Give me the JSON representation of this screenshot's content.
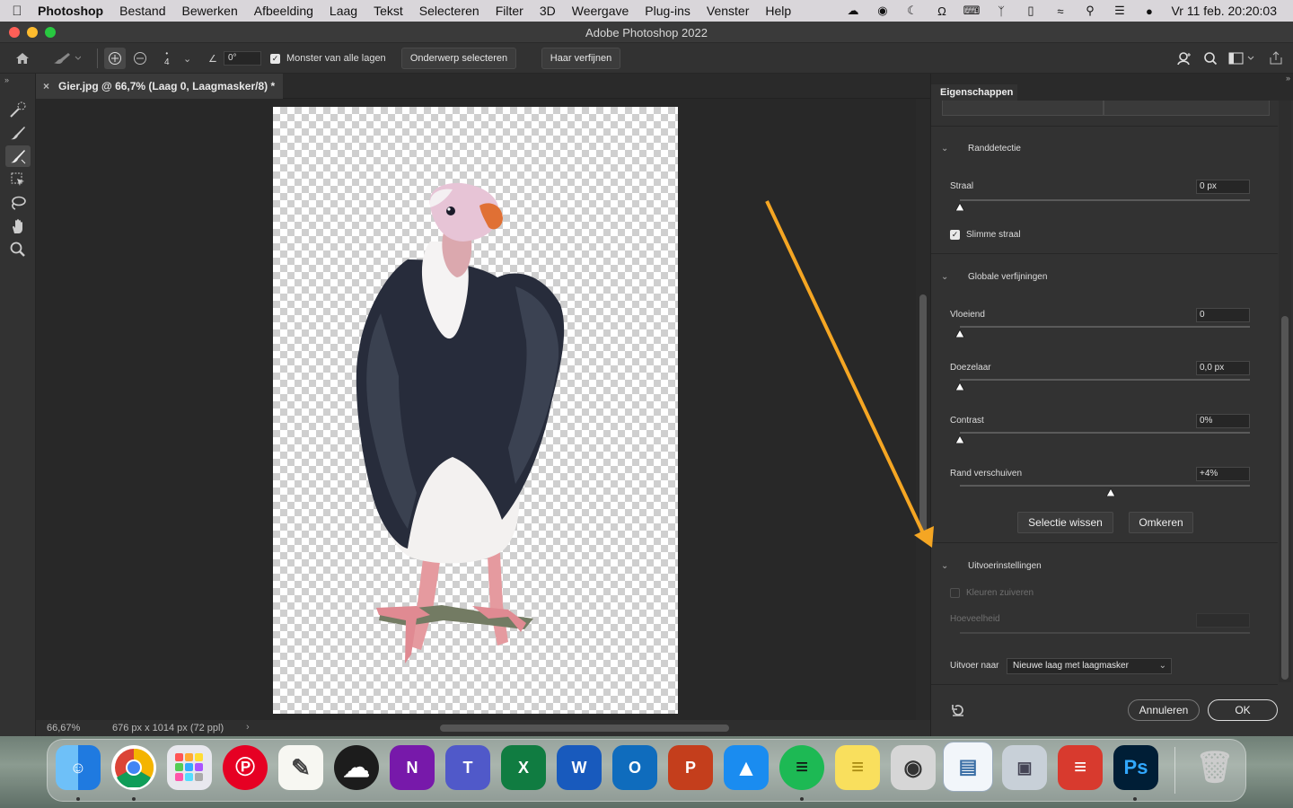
{
  "menubar": {
    "app": "Photoshop",
    "items": [
      "Bestand",
      "Bewerken",
      "Afbeelding",
      "Laag",
      "Tekst",
      "Selecteren",
      "Filter",
      "3D",
      "Weergave",
      "Plug-ins",
      "Venster",
      "Help"
    ],
    "clock": "Vr 11 feb.  20:20:03"
  },
  "window": {
    "title": "Adobe Photoshop 2022"
  },
  "options": {
    "brush_size": "4",
    "angle": "0°",
    "sample_all_label": "Monster van alle lagen",
    "select_subject": "Onderwerp selecteren",
    "refine_hair": "Haar verfijnen"
  },
  "document": {
    "tab_title": "Gier.jpg @ 66,7% (Laag 0, Laagmasker/8) *",
    "zoom": "66,67%",
    "doc_info": "676 px x 1014 px (72 ppl)"
  },
  "properties": {
    "panel_title": "Eigenschappen",
    "partial_tabs": [
      "Randdetectie"
    ],
    "edge_detection": {
      "header": "Randdetectie",
      "radius_label": "Straal",
      "radius_value": "0 px",
      "radius_fraction": 0,
      "smart_radius_label": "Slimme straal"
    },
    "global": {
      "header": "Globale verfijningen",
      "smooth_label": "Vloeiend",
      "smooth_value": "0",
      "smooth_fraction": 0,
      "feather_label": "Doezelaar",
      "feather_value": "0,0 px",
      "feather_fraction": 0,
      "contrast_label": "Contrast",
      "contrast_value": "0%",
      "contrast_fraction": 0,
      "shift_label": "Rand verschuiven",
      "shift_value": "+4%",
      "shift_fraction": 0.52,
      "clear_selection": "Selectie wissen",
      "invert": "Omkeren"
    },
    "output": {
      "header": "Uitvoerinstellingen",
      "decontaminate_label": "Kleuren zuiveren",
      "amount_label": "Hoeveelheid",
      "output_to_label": "Uitvoer naar",
      "output_to_value": "Nieuwe laag met laagmasker"
    },
    "cancel": "Annuleren",
    "ok": "OK"
  },
  "colors": {
    "accent_arrow": "#f5a623",
    "panel_bg": "#323232"
  }
}
